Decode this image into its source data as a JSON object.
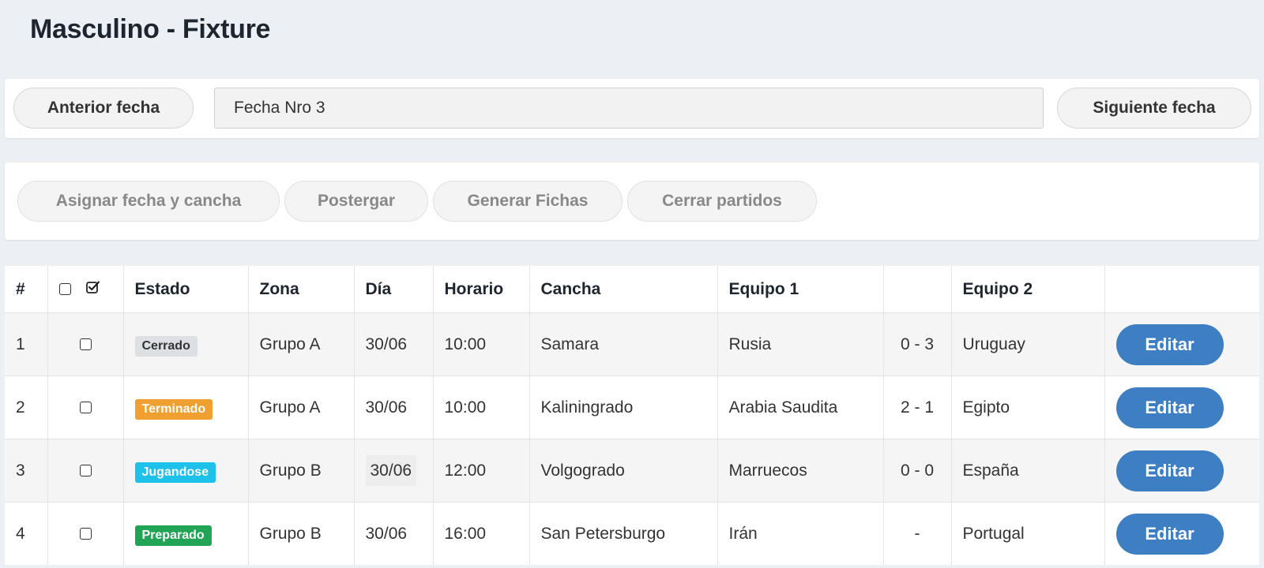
{
  "page": {
    "title": "Masculino - Fixture"
  },
  "nav": {
    "prev_label": "Anterior fecha",
    "date_value": "Fecha Nro 3",
    "next_label": "Siguiente fecha"
  },
  "actions": {
    "assign_label": "Asignar fecha y cancha",
    "postpone_label": "Postergar",
    "generate_label": "Generar Fichas",
    "close_label": "Cerrar partidos"
  },
  "table": {
    "headers": {
      "num": "#",
      "estado": "Estado",
      "zona": "Zona",
      "dia": "Día",
      "horario": "Horario",
      "cancha": "Cancha",
      "equipo1": "Equipo 1",
      "resultado": "",
      "equipo2": "Equipo 2",
      "acciones": ""
    },
    "rows": [
      {
        "num": "1",
        "estado": "Cerrado",
        "estado_color": "#dcdfe3",
        "zona": "Grupo A",
        "dia": "30/06",
        "horario": "10:00",
        "cancha": "Samara",
        "equipo1": "Rusia",
        "resultado": "0 - 3",
        "equipo2": "Uruguay",
        "edit_label": "Editar"
      },
      {
        "num": "2",
        "estado": "Terminado",
        "estado_color": "#f0a030",
        "zona": "Grupo A",
        "dia": "30/06",
        "horario": "10:00",
        "cancha": "Kaliningrado",
        "equipo1": "Arabia Saudita",
        "resultado": "2 - 1",
        "equipo2": "Egipto",
        "edit_label": "Editar"
      },
      {
        "num": "3",
        "estado": "Jugandose",
        "estado_color": "#1ec1ea",
        "zona": "Grupo B",
        "dia": "30/06",
        "horario": "12:00",
        "cancha": "Volgogrado",
        "equipo1": "Marruecos",
        "resultado": "0 - 0",
        "equipo2": "España",
        "edit_label": "Editar"
      },
      {
        "num": "4",
        "estado": "Preparado",
        "estado_color": "#21a455",
        "zona": "Grupo B",
        "dia": "30/06",
        "horario": "16:00",
        "cancha": "San Petersburgo",
        "equipo1": "Irán",
        "resultado": "-",
        "equipo2": "Portugal",
        "edit_label": "Editar"
      }
    ]
  },
  "colors": {
    "background": "#eceff3",
    "primary": "#3e7ec2"
  }
}
